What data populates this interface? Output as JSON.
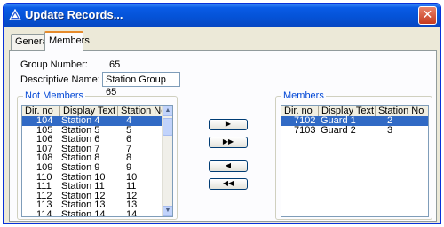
{
  "window": {
    "title": "Update Records...",
    "close_glyph": "✕"
  },
  "tabs": [
    {
      "label": "General"
    },
    {
      "label": "Members"
    }
  ],
  "form": {
    "group_number_label": "Group Number:",
    "group_number_value": "65",
    "descriptive_name_label": "Descriptive Name:",
    "descriptive_name_value": "Station Group 65"
  },
  "not_members": {
    "title": "Not Members",
    "columns": [
      "Dir. no",
      "Display Text",
      "Station No"
    ],
    "rows": [
      [
        "104",
        "Station 4",
        "4"
      ],
      [
        "105",
        "Station 5",
        "5"
      ],
      [
        "106",
        "Station 6",
        "6"
      ],
      [
        "107",
        "Station 7",
        "7"
      ],
      [
        "108",
        "Station 8",
        "8"
      ],
      [
        "109",
        "Station 9",
        "9"
      ],
      [
        "110",
        "Station 10",
        "10"
      ],
      [
        "111",
        "Station 11",
        "11"
      ],
      [
        "112",
        "Station 12",
        "12"
      ],
      [
        "113",
        "Station 13",
        "13"
      ],
      [
        "114",
        "Station 14",
        "14"
      ]
    ],
    "selected_index": 0
  },
  "members": {
    "title": "Members",
    "columns": [
      "Dir. no",
      "Display Text",
      "Station No"
    ],
    "rows": [
      [
        "7102",
        "Guard 1",
        "2"
      ],
      [
        "7103",
        "Guard 2",
        "3"
      ]
    ],
    "selected_index": 0
  },
  "move_buttons": {
    "add_one": "▶",
    "add_all": "▶▶",
    "remove_one": "◀",
    "remove_all": "◀◀"
  },
  "icons": {
    "app": "app-triangle-icon",
    "close": "close-icon",
    "scroll_up": "scroll-up-icon",
    "scroll_down": "scroll-down-icon"
  },
  "colors": {
    "titlebar": "#0553d8",
    "selection": "#316ac5",
    "groupbox_title": "#0046d5"
  }
}
